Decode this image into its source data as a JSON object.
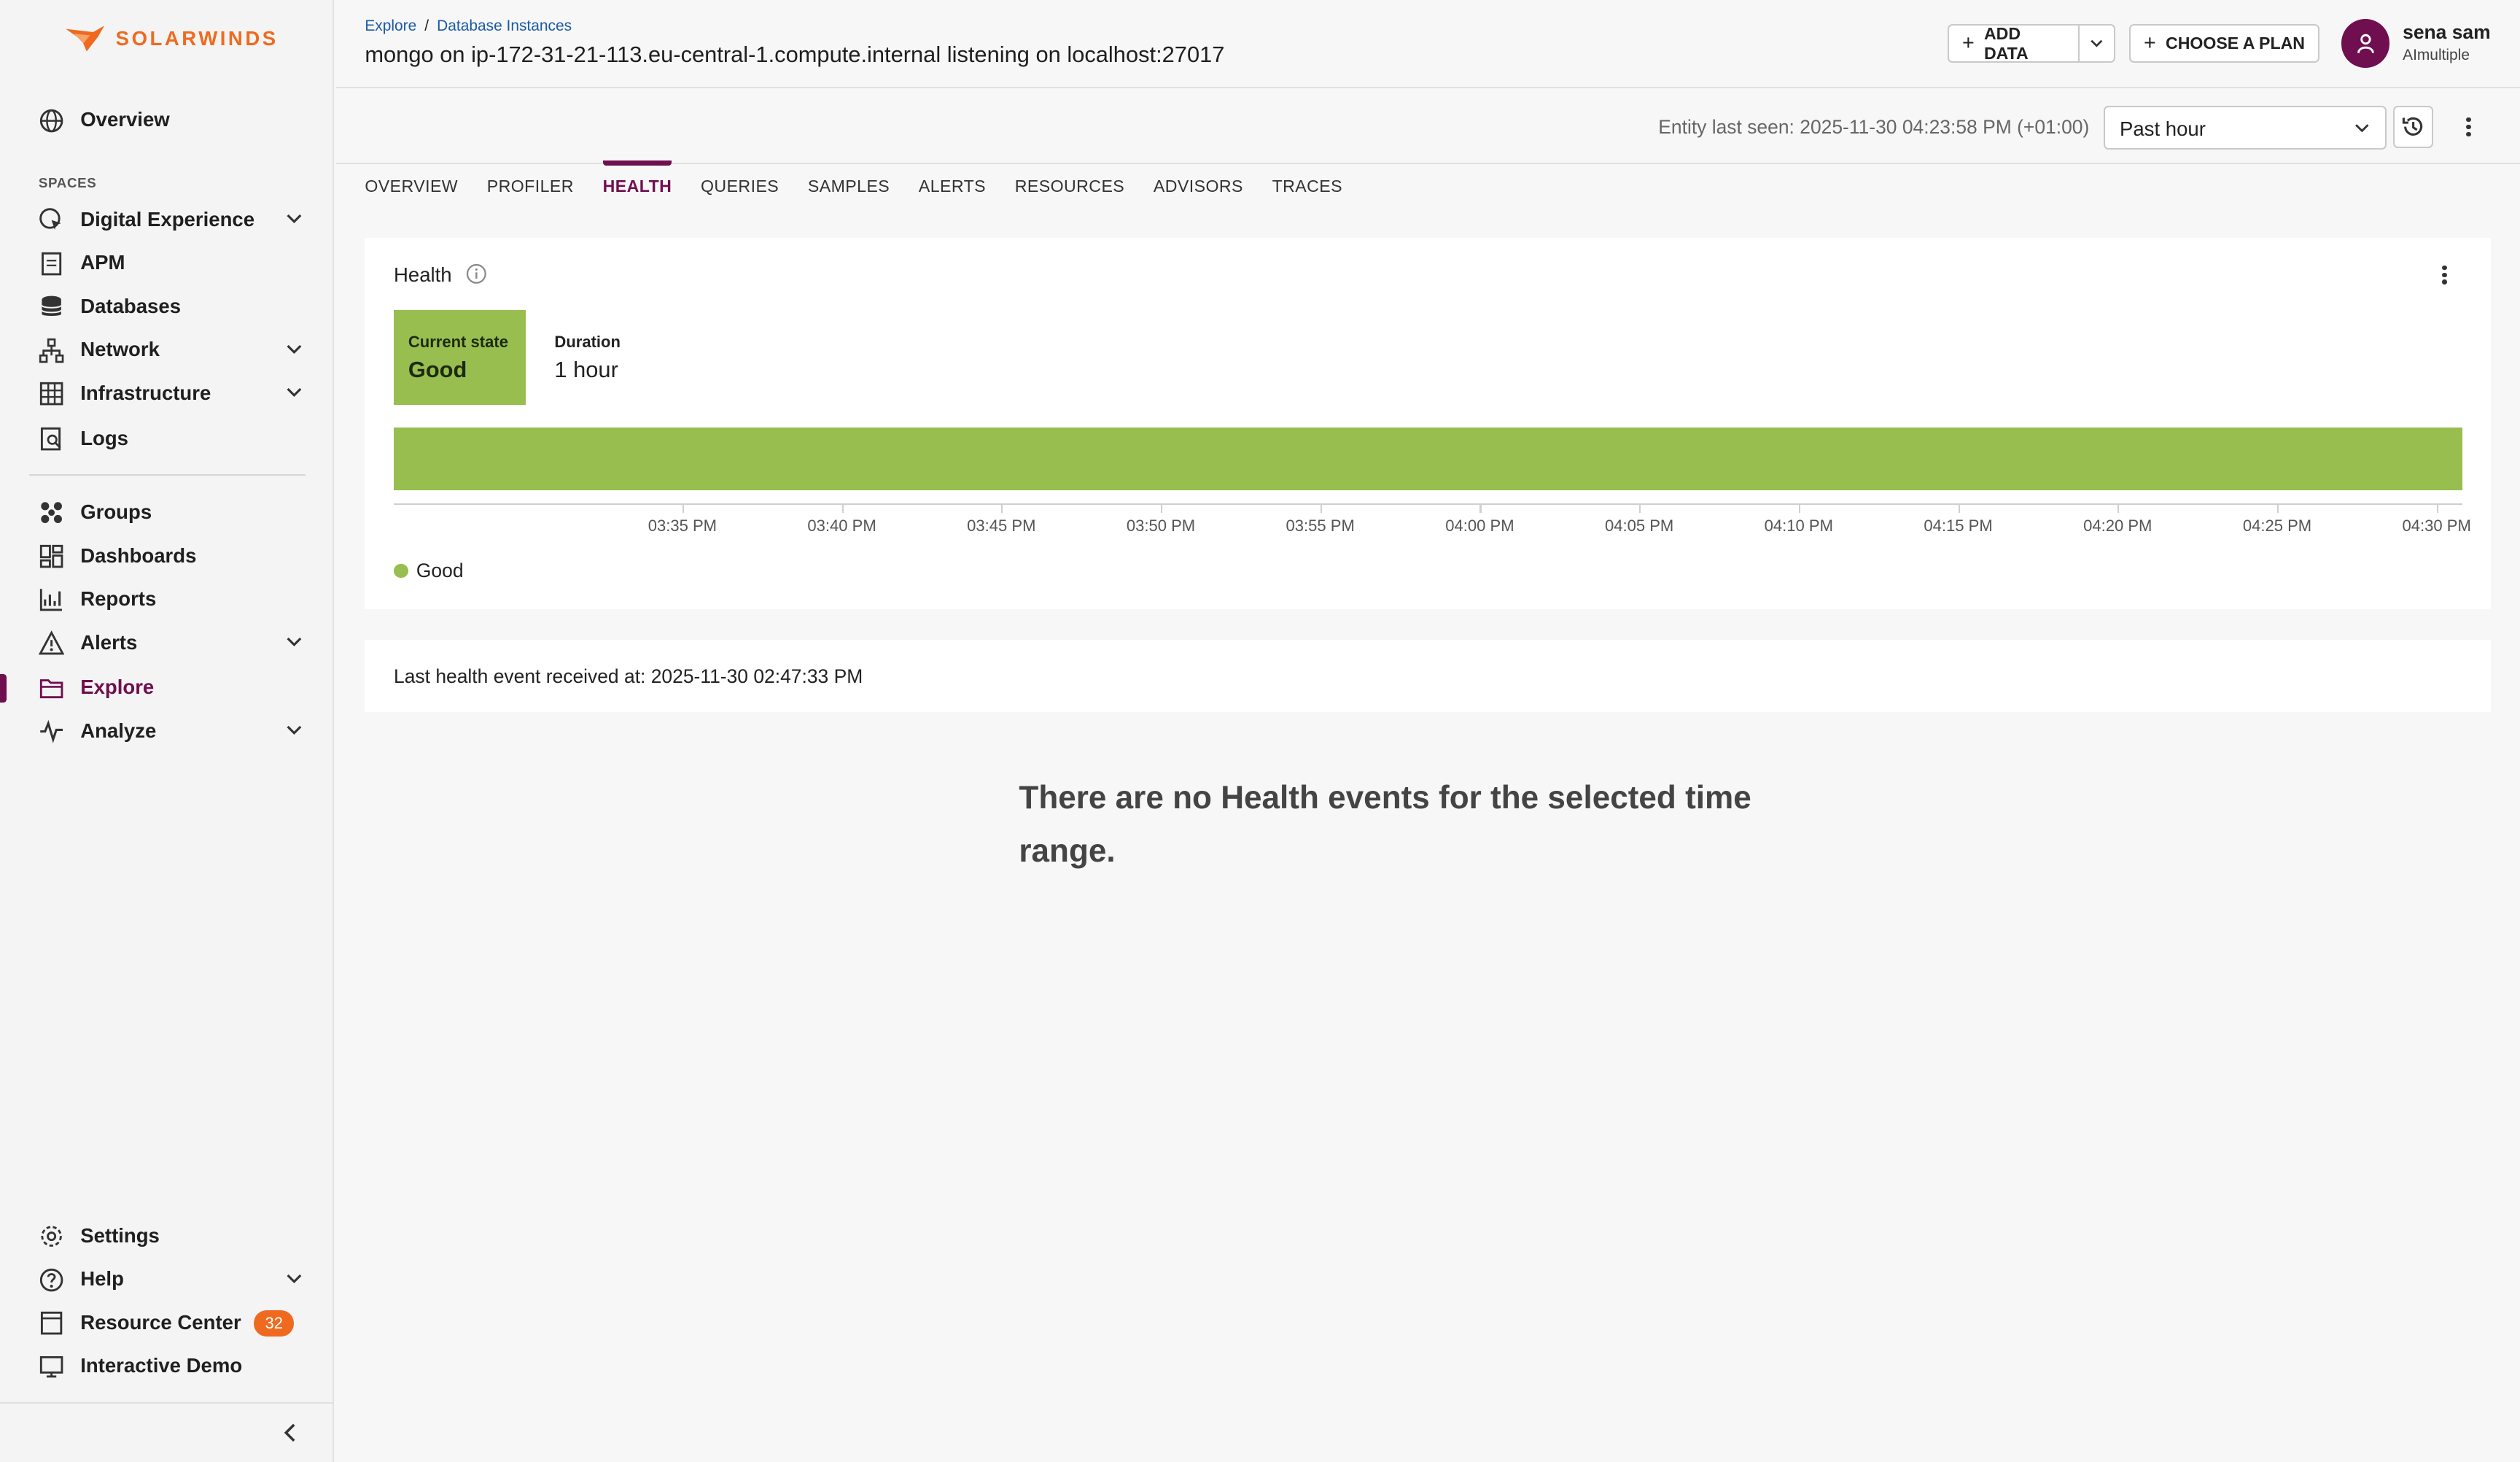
{
  "brand": {
    "name": "SOLARWINDS",
    "color": "#ef6a1f"
  },
  "accent_color": "#6f0f4f",
  "sidebar": {
    "overview": "Overview",
    "spaces_label": "SPACES",
    "spaces": [
      {
        "label": "Digital Experience",
        "icon": "globe-cursor-icon",
        "expandable": true
      },
      {
        "label": "APM",
        "icon": "document-icon",
        "expandable": false
      },
      {
        "label": "Databases",
        "icon": "database-icon",
        "expandable": false
      },
      {
        "label": "Network",
        "icon": "network-icon",
        "expandable": true
      },
      {
        "label": "Infrastructure",
        "icon": "grid-icon",
        "expandable": true
      },
      {
        "label": "Logs",
        "icon": "log-search-icon",
        "expandable": false
      }
    ],
    "tools": [
      {
        "label": "Groups",
        "icon": "groups-icon",
        "expandable": false
      },
      {
        "label": "Dashboards",
        "icon": "dashboard-icon",
        "expandable": false
      },
      {
        "label": "Reports",
        "icon": "chart-icon",
        "expandable": false
      },
      {
        "label": "Alerts",
        "icon": "alert-icon",
        "expandable": true
      },
      {
        "label": "Explore",
        "icon": "folder-icon",
        "expandable": false,
        "active": true
      },
      {
        "label": "Analyze",
        "icon": "pulse-icon",
        "expandable": true
      }
    ],
    "bottom": [
      {
        "label": "Settings",
        "icon": "gear-icon",
        "expandable": false
      },
      {
        "label": "Help",
        "icon": "help-icon",
        "expandable": true
      },
      {
        "label": "Resource Center",
        "icon": "book-icon",
        "badge": "32"
      },
      {
        "label": "Interactive Demo",
        "icon": "monitor-icon"
      }
    ]
  },
  "header": {
    "breadcrumb": [
      "Explore",
      "Database Instances"
    ],
    "breadcrumb_sep": "/",
    "title": "mongo on ip-172-31-21-113.eu-central-1.compute.internal listening on localhost:27017",
    "add_data": "ADD DATA",
    "choose_plan": "CHOOSE A PLAN",
    "user_name": "sena sam",
    "user_org": "AImultiple"
  },
  "subheader": {
    "last_seen": "Entity last seen: 2025-11-30 04:23:58 PM (+01:00)",
    "time_range": "Past hour"
  },
  "tabs": [
    "OVERVIEW",
    "PROFILER",
    "HEALTH",
    "QUERIES",
    "SAMPLES",
    "ALERTS",
    "RESOURCES",
    "ADVISORS",
    "TRACES"
  ],
  "active_tab": "HEALTH",
  "health": {
    "title": "Health",
    "current_state_label": "Current state",
    "current_state": "Good",
    "duration_label": "Duration",
    "duration": "1 hour",
    "legend": "Good",
    "good_color": "#97be4f"
  },
  "chart_data": {
    "type": "bar",
    "orientation": "horizontal-timeline",
    "x_ticks": [
      "03:35 PM",
      "03:40 PM",
      "03:45 PM",
      "03:50 PM",
      "03:55 PM",
      "04:00 PM",
      "04:05 PM",
      "04:10 PM",
      "04:15 PM",
      "04:20 PM",
      "04:25 PM",
      "04:30 PM"
    ],
    "series": [
      {
        "name": "Good",
        "start": "03:26 PM",
        "end": "04:31 PM"
      }
    ],
    "legend_position": "bottom-left"
  },
  "last_event": "Last health event received at: 2025-11-30 02:47:33 PM",
  "empty_message": "There are no Health events for the selected time range."
}
